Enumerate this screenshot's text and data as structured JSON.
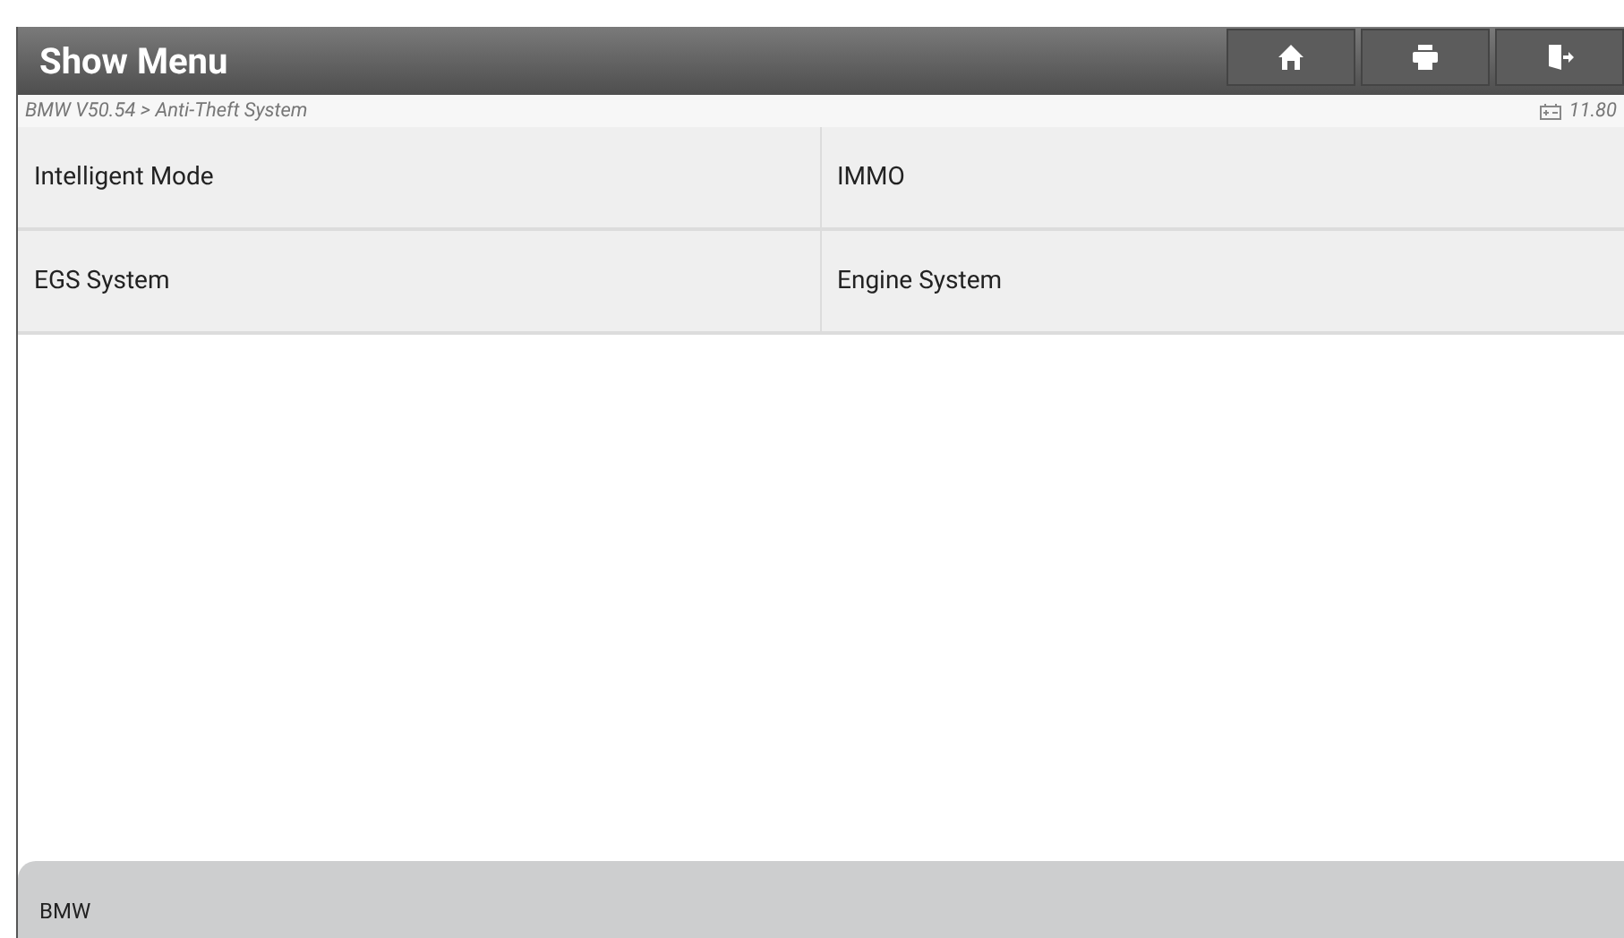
{
  "header": {
    "title": "Show Menu",
    "buttons": [
      {
        "kind": "home"
      },
      {
        "kind": "print"
      },
      {
        "kind": "exit"
      }
    ]
  },
  "breadcrumb": "BMW V50.54 > Anti-Theft System",
  "voltage": "11.80",
  "menu_items": [
    {
      "label": "Intelligent Mode"
    },
    {
      "label": "IMMO"
    },
    {
      "label": "EGS System"
    },
    {
      "label": "Engine System"
    }
  ],
  "footer": "BMW"
}
